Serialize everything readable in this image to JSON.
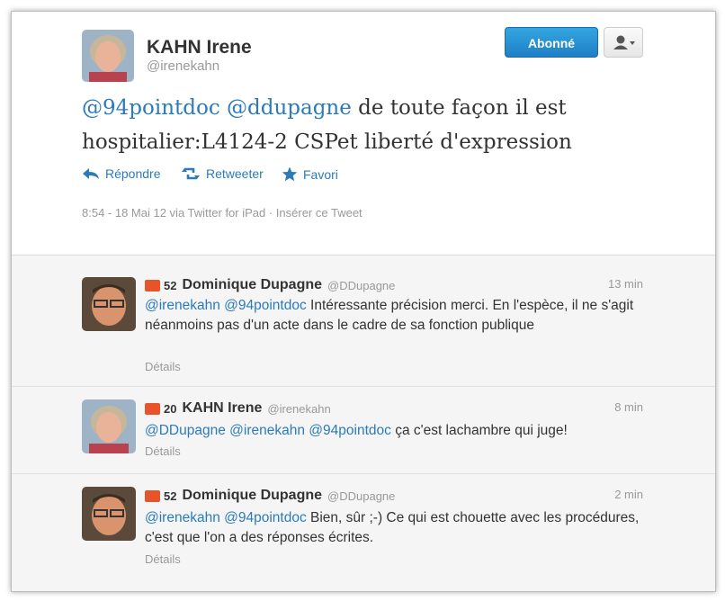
{
  "main_tweet": {
    "name": "KAHN Irene",
    "handle": "@irenekahn",
    "follow_label": "Abonné",
    "text_mentions": [
      "@94pointdoc",
      "@ddupagne"
    ],
    "text_body": "de toute façon il est hospitalier:L4124-2 CSPet liberté d'expression",
    "actions": {
      "reply": "Répondre",
      "retweet": "Retweeter",
      "favorite": "Favori"
    },
    "meta": "8:54 - 18 Mai 12 via Twitter for iPad · Insérer ce Tweet"
  },
  "replies": [
    {
      "klout": "52",
      "name": "Dominique Dupagne",
      "handle": "@DDupagne",
      "time": "13 min",
      "mentions": [
        "@irenekahn",
        "@94pointdoc"
      ],
      "text": "Intéressante précision merci. En l'espèce, il ne s'agit néanmoins pas d'un acte dans le cadre de sa fonction publique",
      "details": "Détails"
    },
    {
      "klout": "20",
      "name": "KAHN Irene",
      "handle": "@irenekahn",
      "time": "8 min",
      "mentions": [
        "@DDupagne",
        "@irenekahn",
        "@94pointdoc"
      ],
      "text": "ça c'est lachambre qui juge!",
      "details": "Détails"
    },
    {
      "klout": "52",
      "name": "Dominique Dupagne",
      "handle": "@DDupagne",
      "time": "2 min",
      "mentions": [
        "@irenekahn",
        "@94pointdoc"
      ],
      "text": "Bien, sûr ;-) Ce qui est chouette avec les procédures, c'est que l'on a des réponses écrites.",
      "details": "Détails"
    }
  ],
  "colors": {
    "link": "#2b7bb9",
    "follow_button": "#1e7fc6",
    "klout": "#e8542a"
  }
}
